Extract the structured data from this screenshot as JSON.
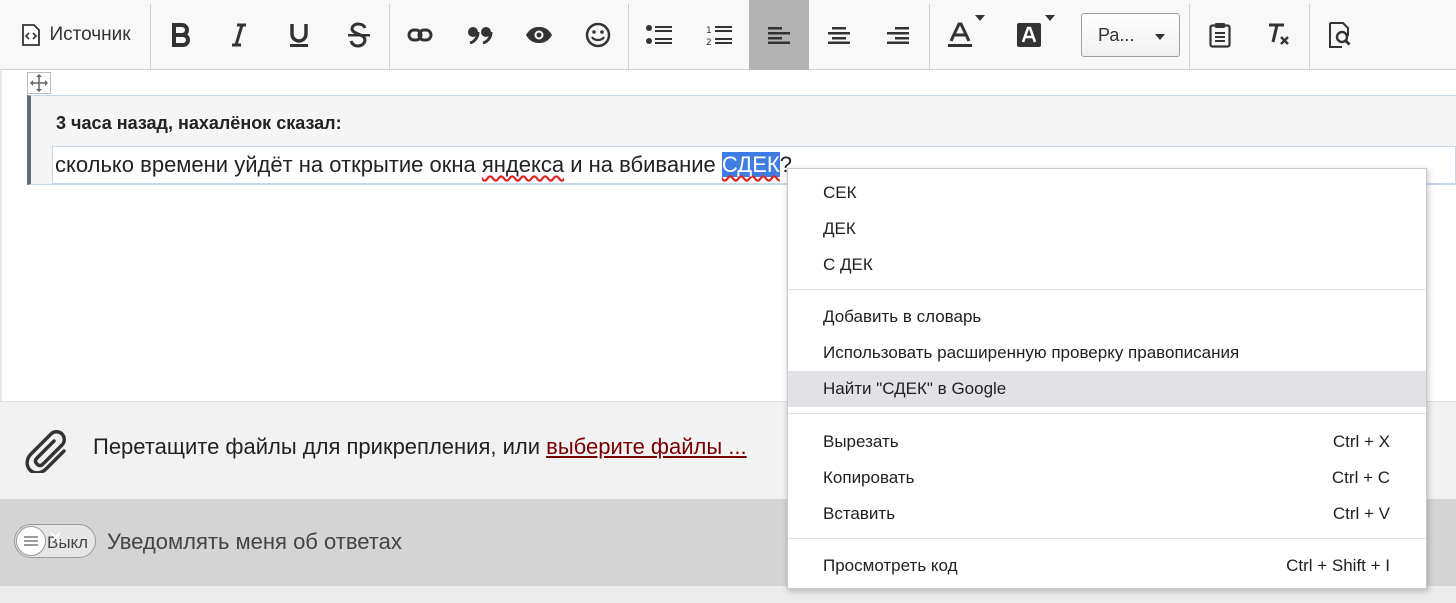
{
  "toolbar": {
    "source_label": "Источник",
    "format_value": "Ра...",
    "icons": [
      "source-icon",
      "bold-icon",
      "italic-icon",
      "underline-icon",
      "strike-icon",
      "link-icon",
      "quote-icon",
      "spoiler-icon",
      "emoji-icon",
      "bullet-list-icon",
      "numbered-list-icon",
      "align-left-icon",
      "align-center-icon",
      "align-right-icon",
      "text-color-icon",
      "bg-color-icon",
      "paste-icon",
      "remove-format-icon",
      "preview-icon"
    ],
    "active_button": "align-left"
  },
  "editor": {
    "quote_author": "3 часа назад, нахалёнок сказал:",
    "text_before": "сколько времени уйдёт на открытие окна ",
    "misspelled_word": "яндекса",
    "text_middle": " и на вбивание ",
    "selected_word": "СДЕК",
    "text_after": "?"
  },
  "attach": {
    "text": "Перетащите файлы для прикрепления, или ",
    "link": "выберите файлы ..."
  },
  "notify": {
    "toggle_label": "Выкл",
    "label": "Уведомлять меня об ответах"
  },
  "context_menu": {
    "suggestions": [
      "СЕК",
      "ДЕК",
      "С ДЕК"
    ],
    "add_to_dictionary": "Добавить в словарь",
    "advanced_spellcheck": "Использовать расширенную проверку правописания",
    "search_google": "Найти \"СДЕК\" в Google",
    "cut": {
      "label": "Вырезать",
      "shortcut": "Ctrl + X"
    },
    "copy": {
      "label": "Копировать",
      "shortcut": "Ctrl + C"
    },
    "paste": {
      "label": "Вставить",
      "shortcut": "Ctrl + V"
    },
    "inspect": {
      "label": "Просмотреть код",
      "shortcut": "Ctrl + Shift + I"
    }
  },
  "colors": {
    "selection": "#3e7ce6",
    "link": "#7a0000",
    "toolbar_active": "#b3b3b3",
    "menu_hover": "#e2e2e6"
  }
}
